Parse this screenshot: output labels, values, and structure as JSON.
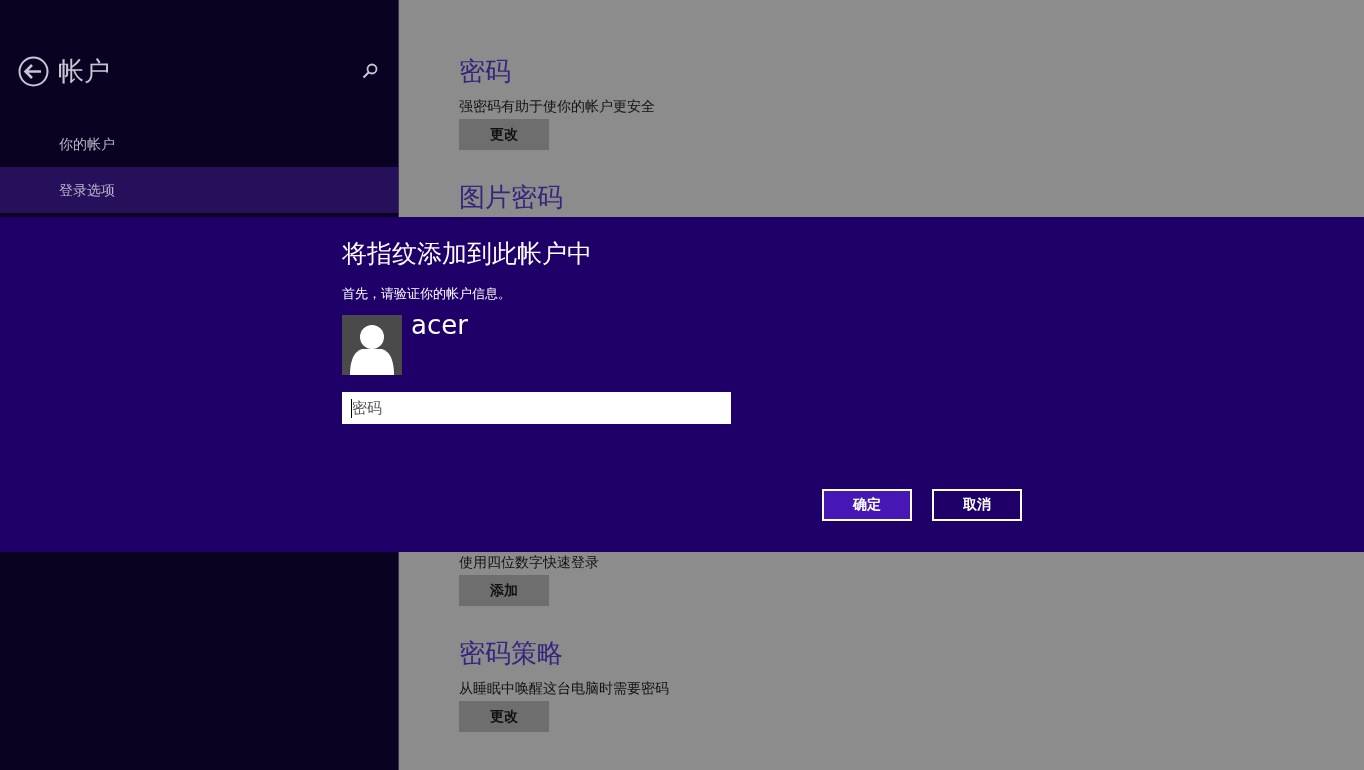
{
  "sidebar": {
    "title": "帐户",
    "items": [
      {
        "label": "你的帐户",
        "selected": false
      },
      {
        "label": "登录选项",
        "selected": true
      }
    ]
  },
  "content": [
    {
      "kind": "heading",
      "text": "密码"
    },
    {
      "kind": "text",
      "text": "强密码有助于使你的帐户更安全"
    },
    {
      "kind": "button",
      "text": "更改"
    },
    {
      "kind": "heading",
      "text": "图片密码"
    },
    {
      "kind": "gap"
    },
    {
      "kind": "text",
      "text": "使用四位数字快速登录"
    },
    {
      "kind": "button",
      "text": "添加"
    },
    {
      "kind": "heading",
      "text": "密码策略"
    },
    {
      "kind": "text",
      "text": "从睡眠中唤醒这台电脑时需要密码"
    },
    {
      "kind": "button",
      "text": "更改"
    }
  ],
  "dialog": {
    "title": "将指纹添加到此帐户中",
    "subtitle": "首先，请验证你的帐户信息。",
    "user_name": "acer",
    "password": {
      "placeholder": "密码",
      "focused": true
    },
    "buttons": [
      {
        "label": "确定",
        "kind": "primary"
      },
      {
        "label": "取消",
        "kind": "secondary"
      }
    ]
  }
}
